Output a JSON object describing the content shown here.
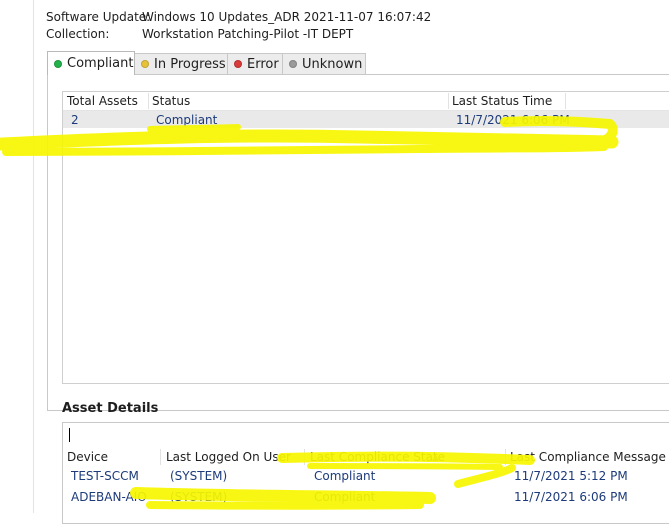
{
  "info": {
    "software_update_label": "Software Update:",
    "software_update_value": "Windows 10 Updates_ADR 2021-11-07 16:07:42",
    "collection_label": "Collection:",
    "collection_value": "Workstation Patching-Pilot -IT DEPT"
  },
  "tabs": [
    {
      "label": "Compliant",
      "color": "#22b14c"
    },
    {
      "label": "In Progress",
      "color": "#e6c23a"
    },
    {
      "label": "Error",
      "color": "#d93a3a"
    },
    {
      "label": "Unknown",
      "color": "#9a9a9a"
    }
  ],
  "status_grid": {
    "columns": [
      "Total Assets",
      "Status",
      "Last Status Time"
    ],
    "rows": [
      {
        "total_assets": "2",
        "status": "Compliant",
        "last_status_time": "11/7/2021 6:06 PM"
      }
    ]
  },
  "asset_details": {
    "title": "Asset Details",
    "columns": [
      "Device",
      "Last Logged On User",
      "Last Compliance State",
      "Last Compliance Message Time"
    ],
    "rows": [
      {
        "device": "TEST-SCCM",
        "user": "(SYSTEM)",
        "state": "Compliant",
        "time": "11/7/2021 5:12 PM"
      },
      {
        "device": "ADEBAN-AIO",
        "user": "(SYSTEM)",
        "state": "Compliant",
        "time": "11/7/2021 6:06 PM"
      }
    ]
  },
  "highlight_color": "#f7f700"
}
